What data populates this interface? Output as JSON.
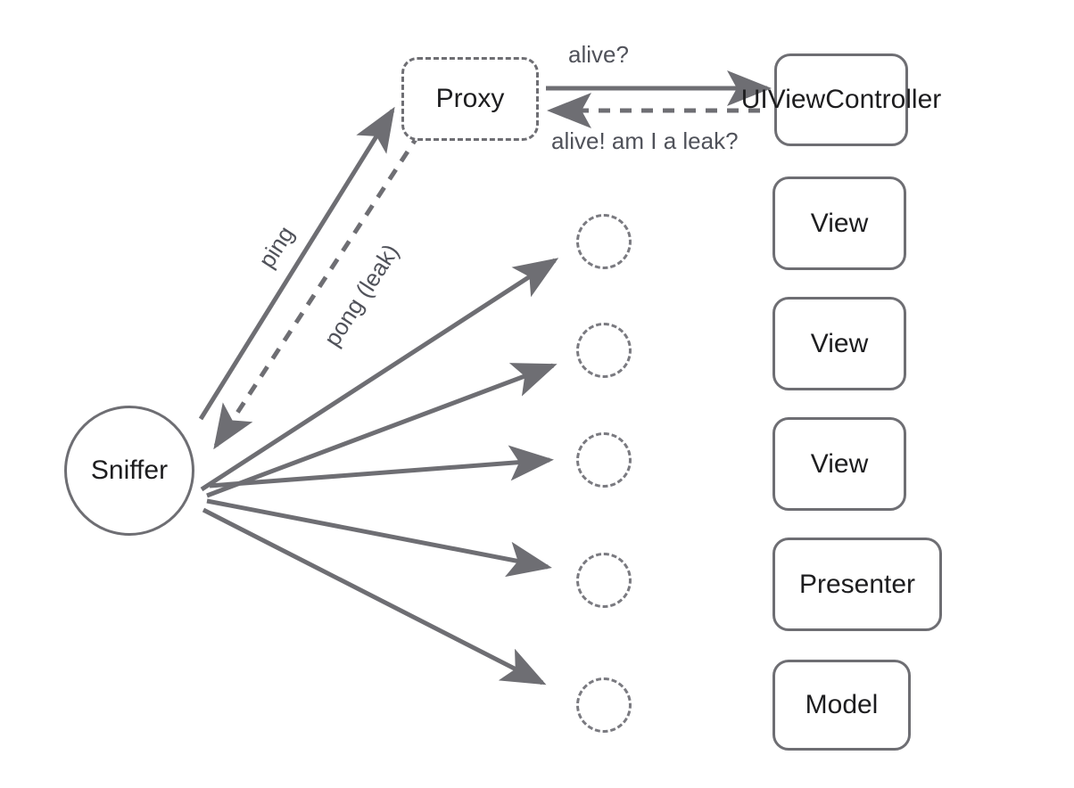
{
  "diagram": {
    "title": "Sniffer proxy leak detection diagram",
    "background_color": "#ffffff",
    "stroke_color": "#6e6e73",
    "text_color": "#1d1d1f",
    "label_color": "#50525a"
  },
  "nodes": {
    "sniffer": {
      "label": "Sniffer",
      "shape": "circle",
      "style": "solid"
    },
    "proxy": {
      "label": "Proxy",
      "shape": "rounded-rect",
      "style": "dashed"
    },
    "uiviewcontroller": {
      "label": "UIViewController",
      "shape": "rounded-rect",
      "style": "solid"
    },
    "view_1": {
      "label": "View",
      "shape": "rounded-rect",
      "style": "solid"
    },
    "view_2": {
      "label": "View",
      "shape": "rounded-rect",
      "style": "solid"
    },
    "view_3": {
      "label": "View",
      "shape": "rounded-rect",
      "style": "solid"
    },
    "presenter": {
      "label": "Presenter",
      "shape": "rounded-rect",
      "style": "solid"
    },
    "model": {
      "label": "Model",
      "shape": "rounded-rect",
      "style": "solid"
    }
  },
  "placeholders": [
    {
      "name": "placeholder-proxy-1",
      "shape": "circle",
      "style": "dashed"
    },
    {
      "name": "placeholder-proxy-2",
      "shape": "circle",
      "style": "dashed"
    },
    {
      "name": "placeholder-proxy-3",
      "shape": "circle",
      "style": "dashed"
    },
    {
      "name": "placeholder-proxy-4",
      "shape": "circle",
      "style": "dashed"
    },
    {
      "name": "placeholder-proxy-5",
      "shape": "circle",
      "style": "dashed"
    }
  ],
  "edges": [
    {
      "id": "ping",
      "label": "ping",
      "from": "sniffer",
      "to": "proxy",
      "style": "solid",
      "direction": "forward"
    },
    {
      "id": "pong",
      "label": "pong (leak)",
      "from": "proxy",
      "to": "sniffer",
      "style": "dashed",
      "direction": "forward"
    },
    {
      "id": "alive-question",
      "label": "alive?",
      "from": "proxy",
      "to": "uiviewcontroller",
      "style": "solid",
      "direction": "forward"
    },
    {
      "id": "alive-answer",
      "label": "alive! am I a leak?",
      "from": "uiviewcontroller",
      "to": "proxy",
      "style": "dashed",
      "direction": "forward"
    },
    {
      "id": "sniff-1",
      "label": "",
      "from": "sniffer",
      "to": "placeholder-proxy-1",
      "style": "solid",
      "direction": "forward"
    },
    {
      "id": "sniff-2",
      "label": "",
      "from": "sniffer",
      "to": "placeholder-proxy-2",
      "style": "solid",
      "direction": "forward"
    },
    {
      "id": "sniff-3",
      "label": "",
      "from": "sniffer",
      "to": "placeholder-proxy-3",
      "style": "solid",
      "direction": "forward"
    },
    {
      "id": "sniff-4",
      "label": "",
      "from": "sniffer",
      "to": "placeholder-proxy-4",
      "style": "solid",
      "direction": "forward"
    },
    {
      "id": "sniff-5",
      "label": "",
      "from": "sniffer",
      "to": "placeholder-proxy-5",
      "style": "solid",
      "direction": "forward"
    }
  ]
}
